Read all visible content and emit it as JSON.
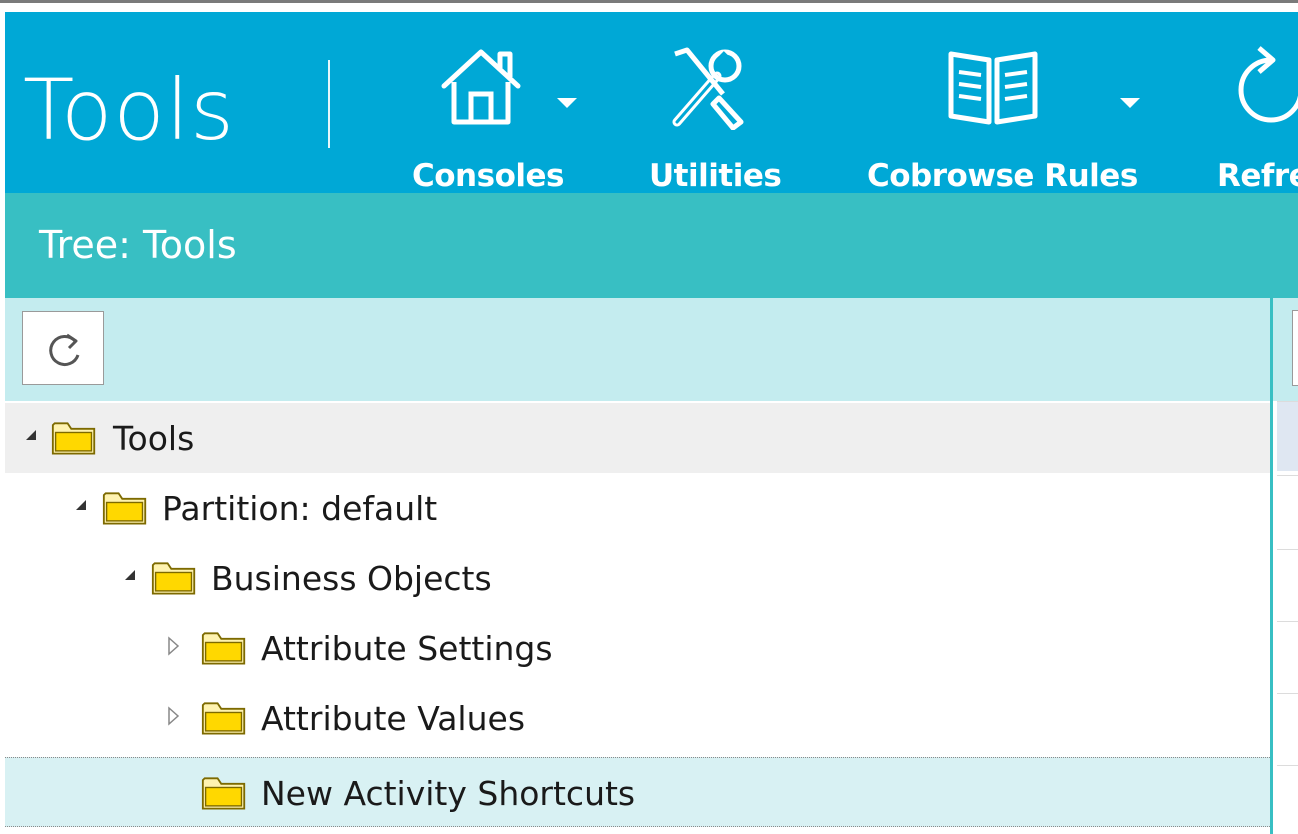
{
  "toolbar": {
    "title": "Tools",
    "buttons": [
      {
        "label": "Consoles",
        "icon": "house-icon",
        "has_dropdown": true
      },
      {
        "label": "Utilities",
        "icon": "tools-icon",
        "has_dropdown": false
      },
      {
        "label": "Cobrowse Rules",
        "icon": "book-icon",
        "has_dropdown": true
      },
      {
        "label": "Refre",
        "icon": "refresh-icon",
        "has_dropdown": false
      }
    ]
  },
  "tree_panel": {
    "header": "Tree: Tools",
    "refresh_icon": "refresh-icon"
  },
  "tree": {
    "nodes": [
      {
        "label": "Tools",
        "level": 0,
        "expander": "expanded",
        "state": "selected"
      },
      {
        "label": "Partition: default",
        "level": 1,
        "expander": "expanded",
        "state": "normal"
      },
      {
        "label": "Business Objects",
        "level": 2,
        "expander": "expanded",
        "state": "normal"
      },
      {
        "label": "Attribute Settings",
        "level": 3,
        "expander": "collapsed",
        "state": "normal"
      },
      {
        "label": "Attribute Values",
        "level": 3,
        "expander": "collapsed",
        "state": "normal"
      },
      {
        "label": "New Activity Shortcuts",
        "level": 3,
        "expander": "none",
        "state": "hover"
      }
    ]
  },
  "colors": {
    "toolbar_bg": "#00a8d6",
    "tree_header_bg": "#38bfc3",
    "tree_tools_bg": "#c4ecef",
    "folder_fill": "#ffd800",
    "folder_stroke": "#8a7000"
  }
}
